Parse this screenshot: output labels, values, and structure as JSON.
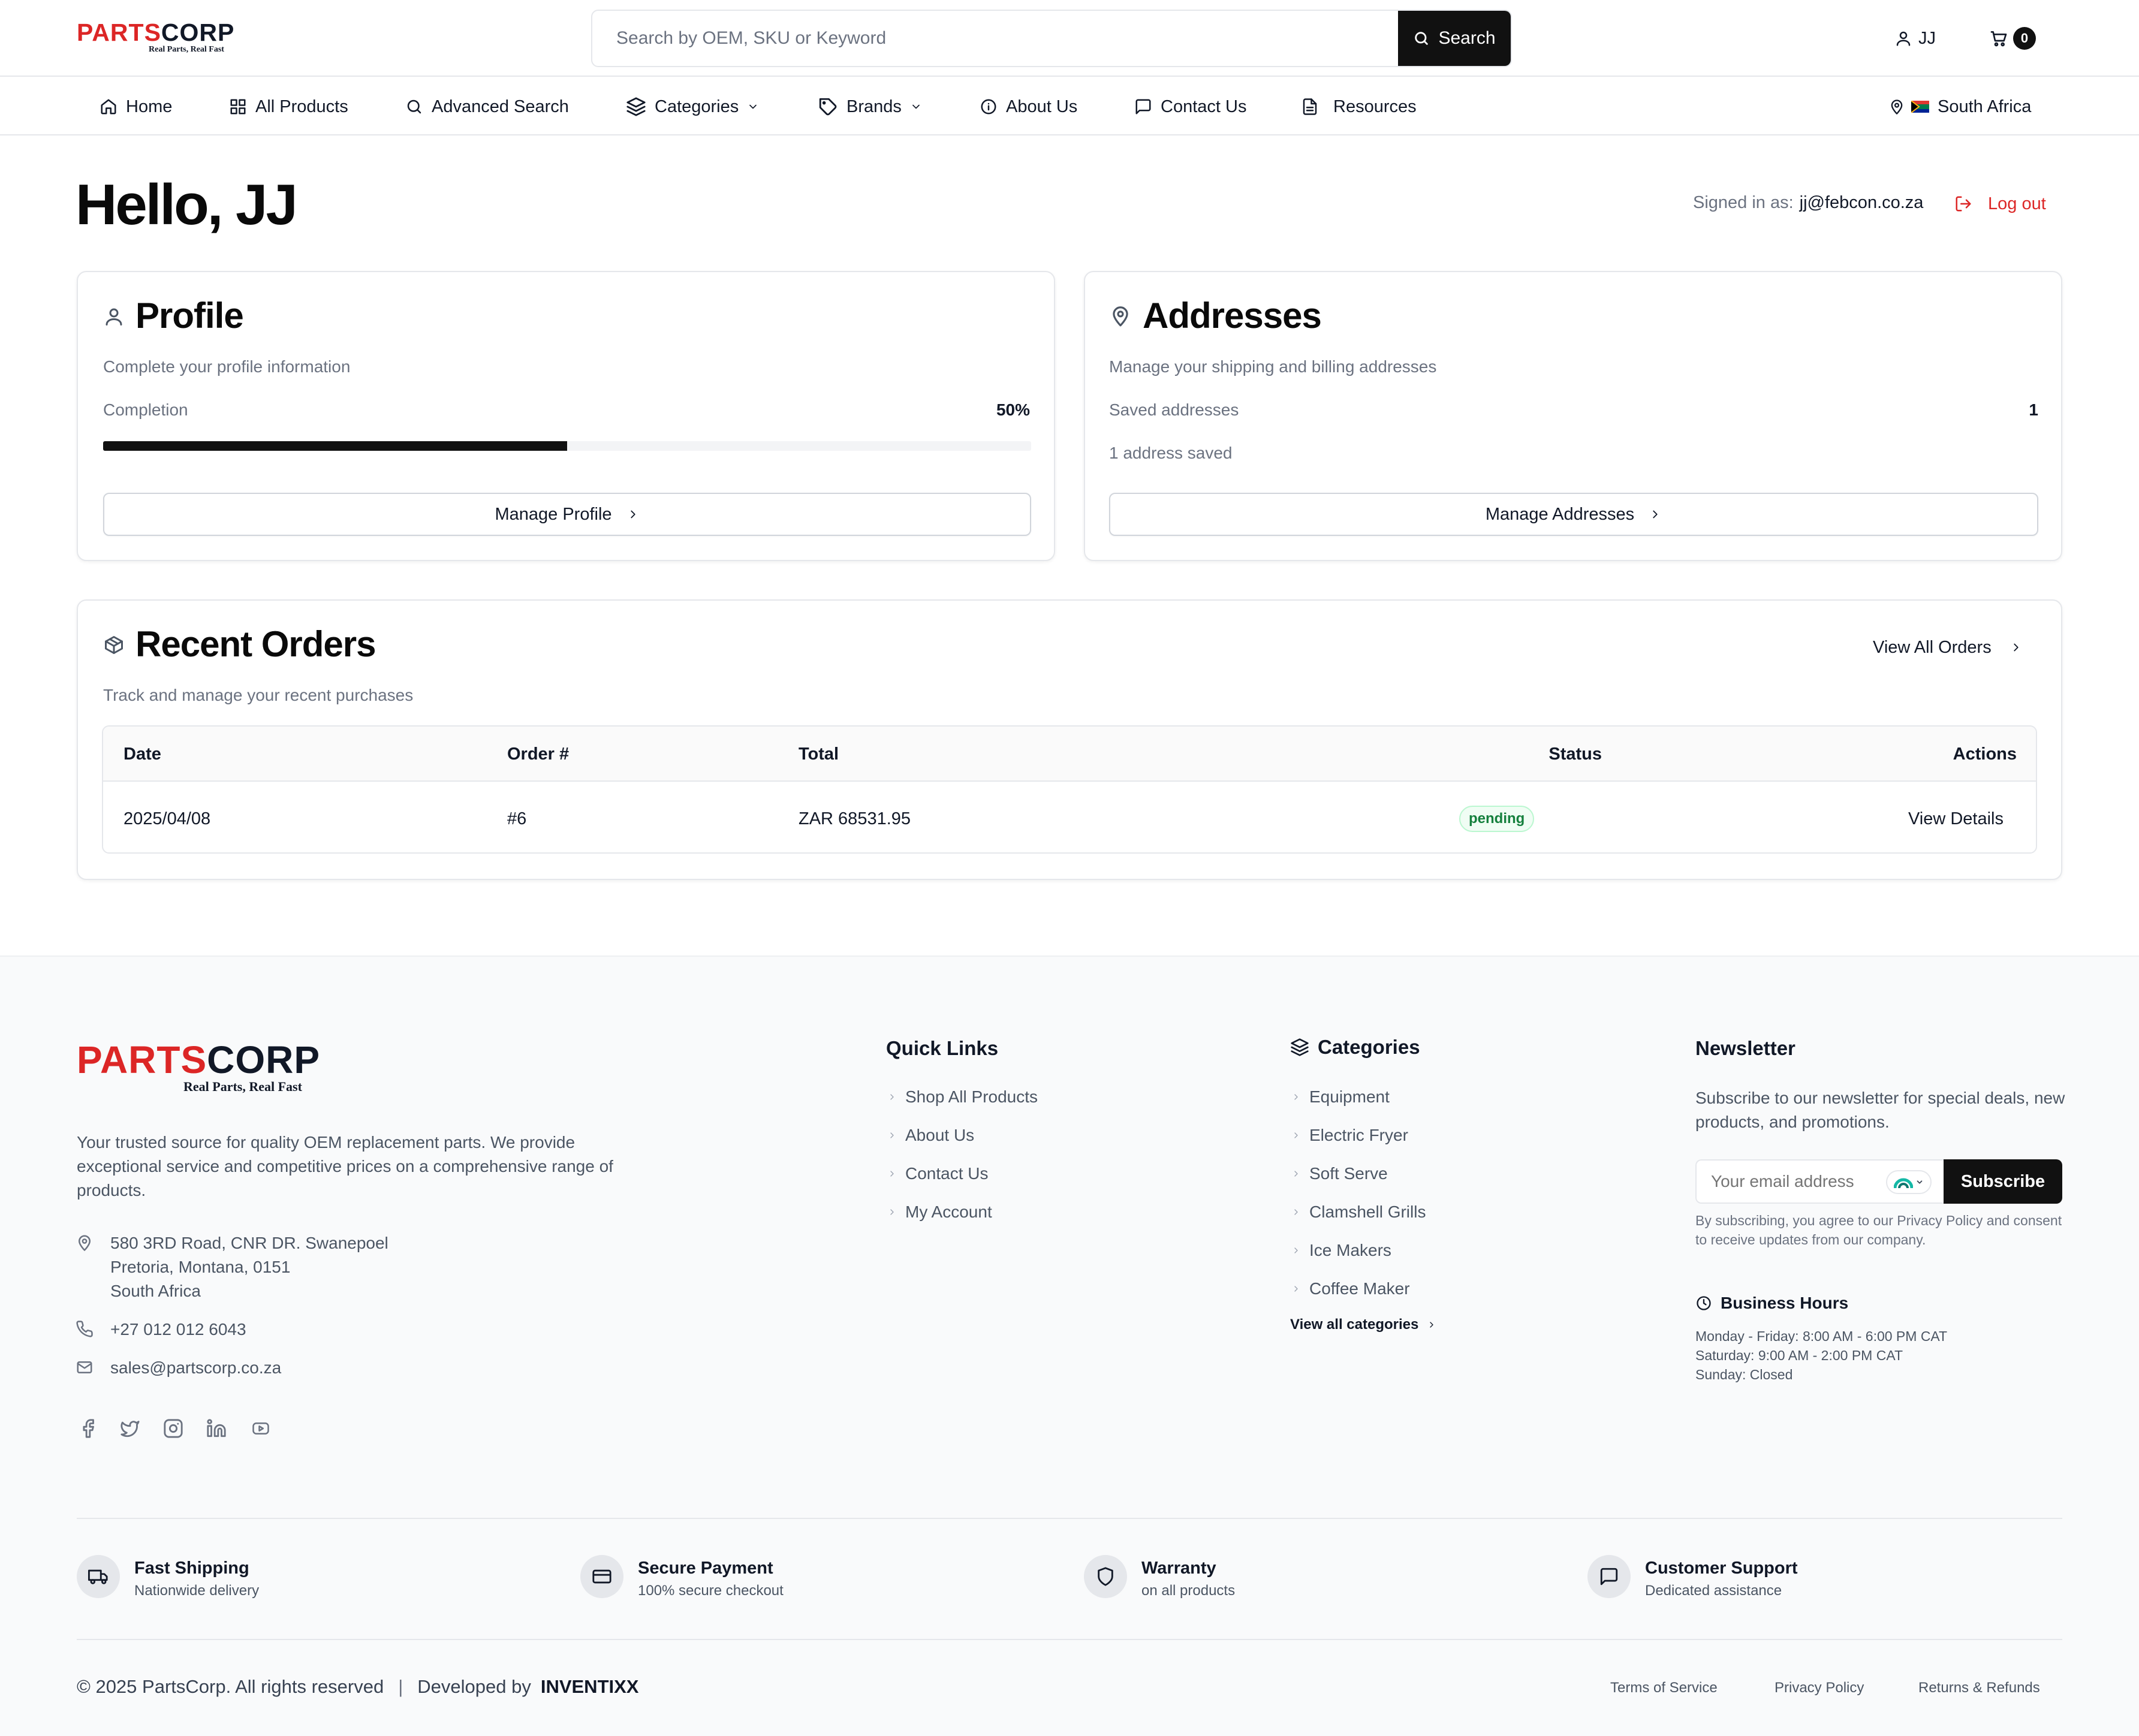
{
  "brand": {
    "name_part1": "PARTS",
    "name_part2": "CORP",
    "tagline": "Real Parts, Real Fast"
  },
  "header": {
    "search_placeholder": "Search by OEM, SKU or Keyword",
    "search_button": "Search",
    "user_label": "JJ",
    "cart_count": "0"
  },
  "nav": {
    "items": [
      "Home",
      "All Products",
      "Advanced Search",
      "Categories",
      "Brands",
      "About Us",
      "Contact Us",
      "Resources"
    ],
    "region": "South Africa"
  },
  "page": {
    "greeting": "Hello, JJ",
    "signed_in_label": "Signed in as:",
    "signed_in_email": "jj@febcon.co.za",
    "logout": "Log out"
  },
  "profile_card": {
    "title": "Profile",
    "description": "Complete your profile information",
    "completion_label": "Completion",
    "completion_value": "50%",
    "completion_fraction": 0.5,
    "button": "Manage Profile"
  },
  "addresses_card": {
    "title": "Addresses",
    "description": "Manage your shipping and billing addresses",
    "saved_label": "Saved addresses",
    "saved_count": "1",
    "saved_note": "1 address saved",
    "button": "Manage Addresses"
  },
  "orders_card": {
    "title": "Recent Orders",
    "description": "Track and manage your recent purchases",
    "view_all": "View All Orders",
    "columns": [
      "Date",
      "Order #",
      "Total",
      "Status",
      "Actions"
    ],
    "rows": [
      {
        "date": "2025/04/08",
        "order": "#6",
        "total": "ZAR 68531.95",
        "status": "pending",
        "action": "View Details"
      }
    ]
  },
  "footer": {
    "about": "Your trusted source for quality OEM replacement parts. We provide exceptional service and competitive prices on a comprehensive range of products.",
    "address_lines": [
      "580 3RD Road, CNR DR. Swanepoel",
      "Pretoria, Montana, 0151",
      "South Africa"
    ],
    "phone": "+27 012 012 6043",
    "email": "sales@partscorp.co.za",
    "quick_links_title": "Quick Links",
    "quick_links": [
      "Shop All Products",
      "About Us",
      "Contact Us",
      "My Account"
    ],
    "categories_title": "Categories",
    "categories": [
      "Equipment",
      "Electric Fryer",
      "Soft Serve",
      "Clamshell Grills",
      "Ice Makers",
      "Coffee Maker"
    ],
    "view_all_categories": "View all categories",
    "newsletter_title": "Newsletter",
    "newsletter_text": "Subscribe to our newsletter for special deals, new products, and promotions.",
    "email_placeholder": "Your email address",
    "subscribe_button": "Subscribe",
    "newsletter_disclaimer": "By subscribing, you agree to our Privacy Policy and consent to receive updates from our company.",
    "hours_title": "Business Hours",
    "hours": [
      "Monday - Friday: 8:00 AM - 6:00 PM CAT",
      "Saturday: 9:00 AM - 2:00 PM CAT",
      "Sunday: Closed"
    ],
    "features": [
      {
        "title": "Fast Shipping",
        "sub": "Nationwide delivery",
        "icon": "truck-icon"
      },
      {
        "title": "Secure Payment",
        "sub": "100% secure checkout",
        "icon": "credit-card-icon"
      },
      {
        "title": "Warranty",
        "sub": "on all products",
        "icon": "shield-icon"
      },
      {
        "title": "Customer Support",
        "sub": "Dedicated assistance",
        "icon": "message-icon"
      }
    ],
    "copyright": "© 2025 PartsCorp. All rights reserved",
    "separator": "|",
    "developed_by": "Developed by",
    "developer": "INVENTIXX",
    "legal_links": [
      "Terms of Service",
      "Privacy Policy",
      "Returns & Refunds"
    ]
  },
  "colors": {
    "brand_red": "#dc2626",
    "dark": "#111111",
    "status_green": "#15803d",
    "status_green_bg": "#f0fdf4"
  }
}
